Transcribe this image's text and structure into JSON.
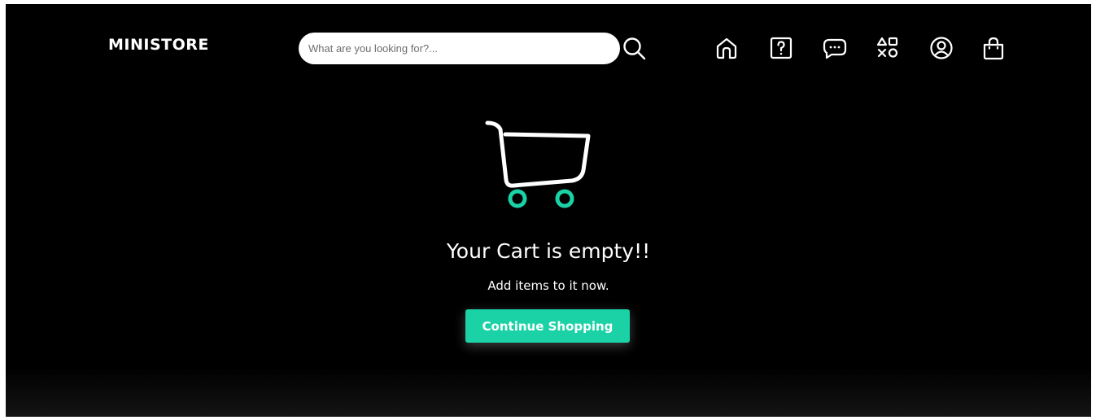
{
  "brand": {
    "name": "MINISTORE"
  },
  "search": {
    "placeholder": "What are you looking for?..."
  },
  "nav_icons": [
    "search-icon",
    "home-icon",
    "help-icon",
    "chat-icon",
    "categories-icon",
    "account-icon",
    "bag-icon"
  ],
  "empty_cart": {
    "title": "Your Cart is empty!!",
    "subtitle": "Add items to it now.",
    "button_label": "Continue Shopping"
  },
  "colors": {
    "background": "#000000",
    "accent": "#1ad2a6",
    "text": "#ffffff"
  }
}
